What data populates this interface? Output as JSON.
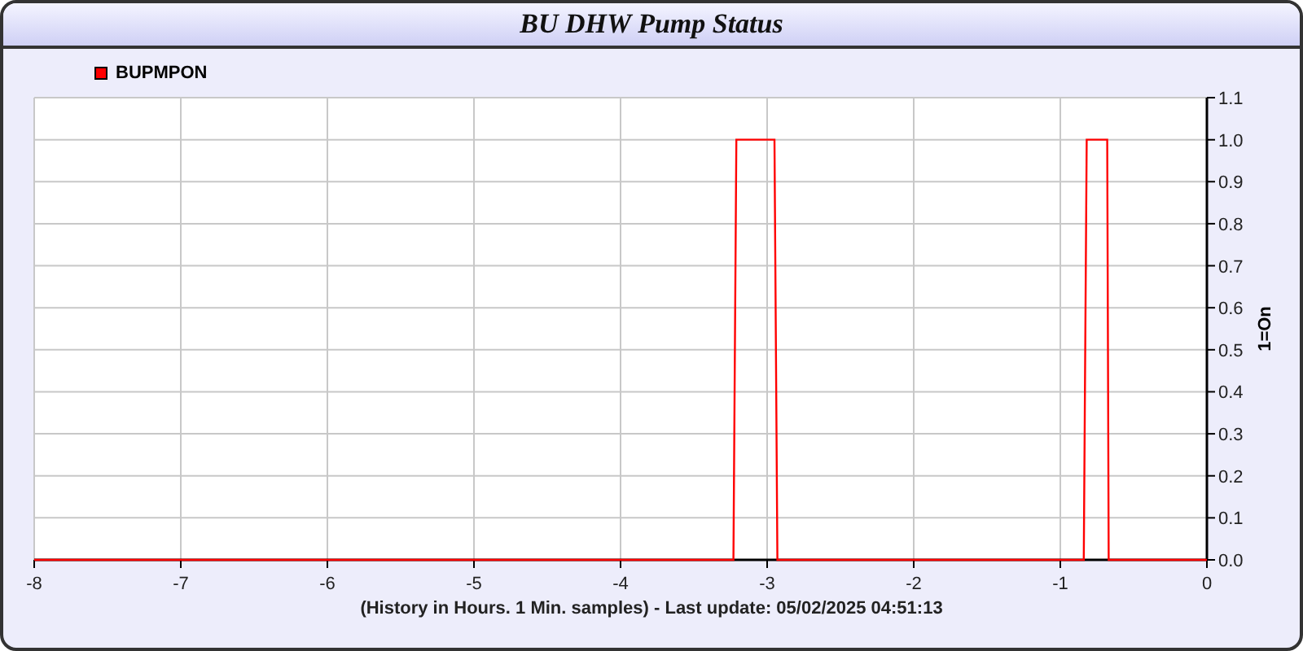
{
  "window": {
    "title": "BU DHW Pump Status"
  },
  "chart": {
    "chart_data": {
      "type": "line",
      "ylabel": "1=On",
      "xlabel": "(History in Hours. 1 Min. samples) - Last update: 05/02/2025 04:51:13",
      "x": [
        -8,
        -3.23,
        -3.21,
        -2.95,
        -2.93,
        -0.84,
        -0.82,
        -0.68,
        -0.67,
        0
      ],
      "series": [
        {
          "name": "BUPMPON",
          "color": "#ff0000",
          "values": [
            0,
            0,
            1,
            1,
            0,
            0,
            1,
            1,
            0,
            0
          ]
        }
      ],
      "grid": true,
      "xlim": [
        -8,
        0
      ],
      "ylim": [
        0,
        1.1
      ],
      "xticks": [
        -8,
        -7,
        -6,
        -5,
        -4,
        -3,
        -2,
        -1,
        0
      ],
      "yticks": [
        {
          "value": 0,
          "label": "0.0"
        },
        {
          "value": 0.1,
          "label": "0.1"
        },
        {
          "value": 0.2,
          "label": "0.2"
        },
        {
          "value": 0.3,
          "label": "0.3"
        },
        {
          "value": 0.4,
          "label": "0.4"
        },
        {
          "value": 0.5,
          "label": "0.5"
        },
        {
          "value": 0.6,
          "label": "0.6"
        },
        {
          "value": 0.7,
          "label": "0.7"
        },
        {
          "value": 0.8,
          "label": "0.8"
        },
        {
          "value": 0.9,
          "label": "0.9"
        },
        {
          "value": 1,
          "label": "1.0"
        },
        {
          "value": 1.1,
          "label": "1.1"
        }
      ]
    }
  }
}
